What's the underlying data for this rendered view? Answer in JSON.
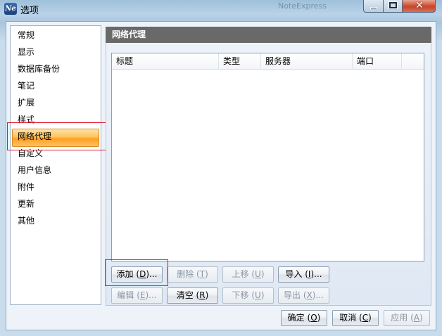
{
  "window": {
    "title": "选项",
    "app_icon_text": "Ne",
    "background_window_title": "NoteExpress",
    "controls": [
      "minimize-icon",
      "maximize-icon",
      "close-icon"
    ]
  },
  "sidebar": {
    "items": [
      {
        "label": "常规"
      },
      {
        "label": "显示"
      },
      {
        "label": "数据库备份"
      },
      {
        "label": "笔记"
      },
      {
        "label": "扩展"
      },
      {
        "label": "样式"
      },
      {
        "label": "网络代理",
        "selected": true
      },
      {
        "label": "自定义"
      },
      {
        "label": "用户信息"
      },
      {
        "label": "附件"
      },
      {
        "label": "更新"
      },
      {
        "label": "其他"
      }
    ]
  },
  "panel": {
    "title": "网络代理",
    "table": {
      "columns": [
        "标题",
        "类型",
        "服务器",
        "端口"
      ],
      "rows": []
    },
    "buttons": {
      "add": {
        "label": "添加",
        "key": "D",
        "suffix": "...",
        "enabled": true
      },
      "delete": {
        "label": "删除",
        "key": "T",
        "suffix": "",
        "enabled": false
      },
      "move_up": {
        "label": "上移",
        "key": "U",
        "suffix": "",
        "enabled": false
      },
      "import": {
        "label": "导入",
        "key": "I",
        "suffix": "...",
        "enabled": true
      },
      "edit": {
        "label": "编辑",
        "key": "E",
        "suffix": "...",
        "enabled": false
      },
      "clear": {
        "label": "清空",
        "key": "R",
        "suffix": "",
        "enabled": true
      },
      "move_down": {
        "label": "下移",
        "key": "U",
        "suffix": "",
        "enabled": false
      },
      "export": {
        "label": "导出",
        "key": "X",
        "suffix": "...",
        "enabled": false
      }
    }
  },
  "footer": {
    "ok": {
      "label": "确定",
      "key": "O",
      "enabled": true
    },
    "cancel": {
      "label": "取消",
      "key": "C",
      "enabled": true
    },
    "apply": {
      "label": "应用",
      "key": "A",
      "enabled": false
    }
  },
  "colors": {
    "panel_header": "#696969",
    "selection": "#ffa62b",
    "highlight_box": "#e0182a"
  }
}
